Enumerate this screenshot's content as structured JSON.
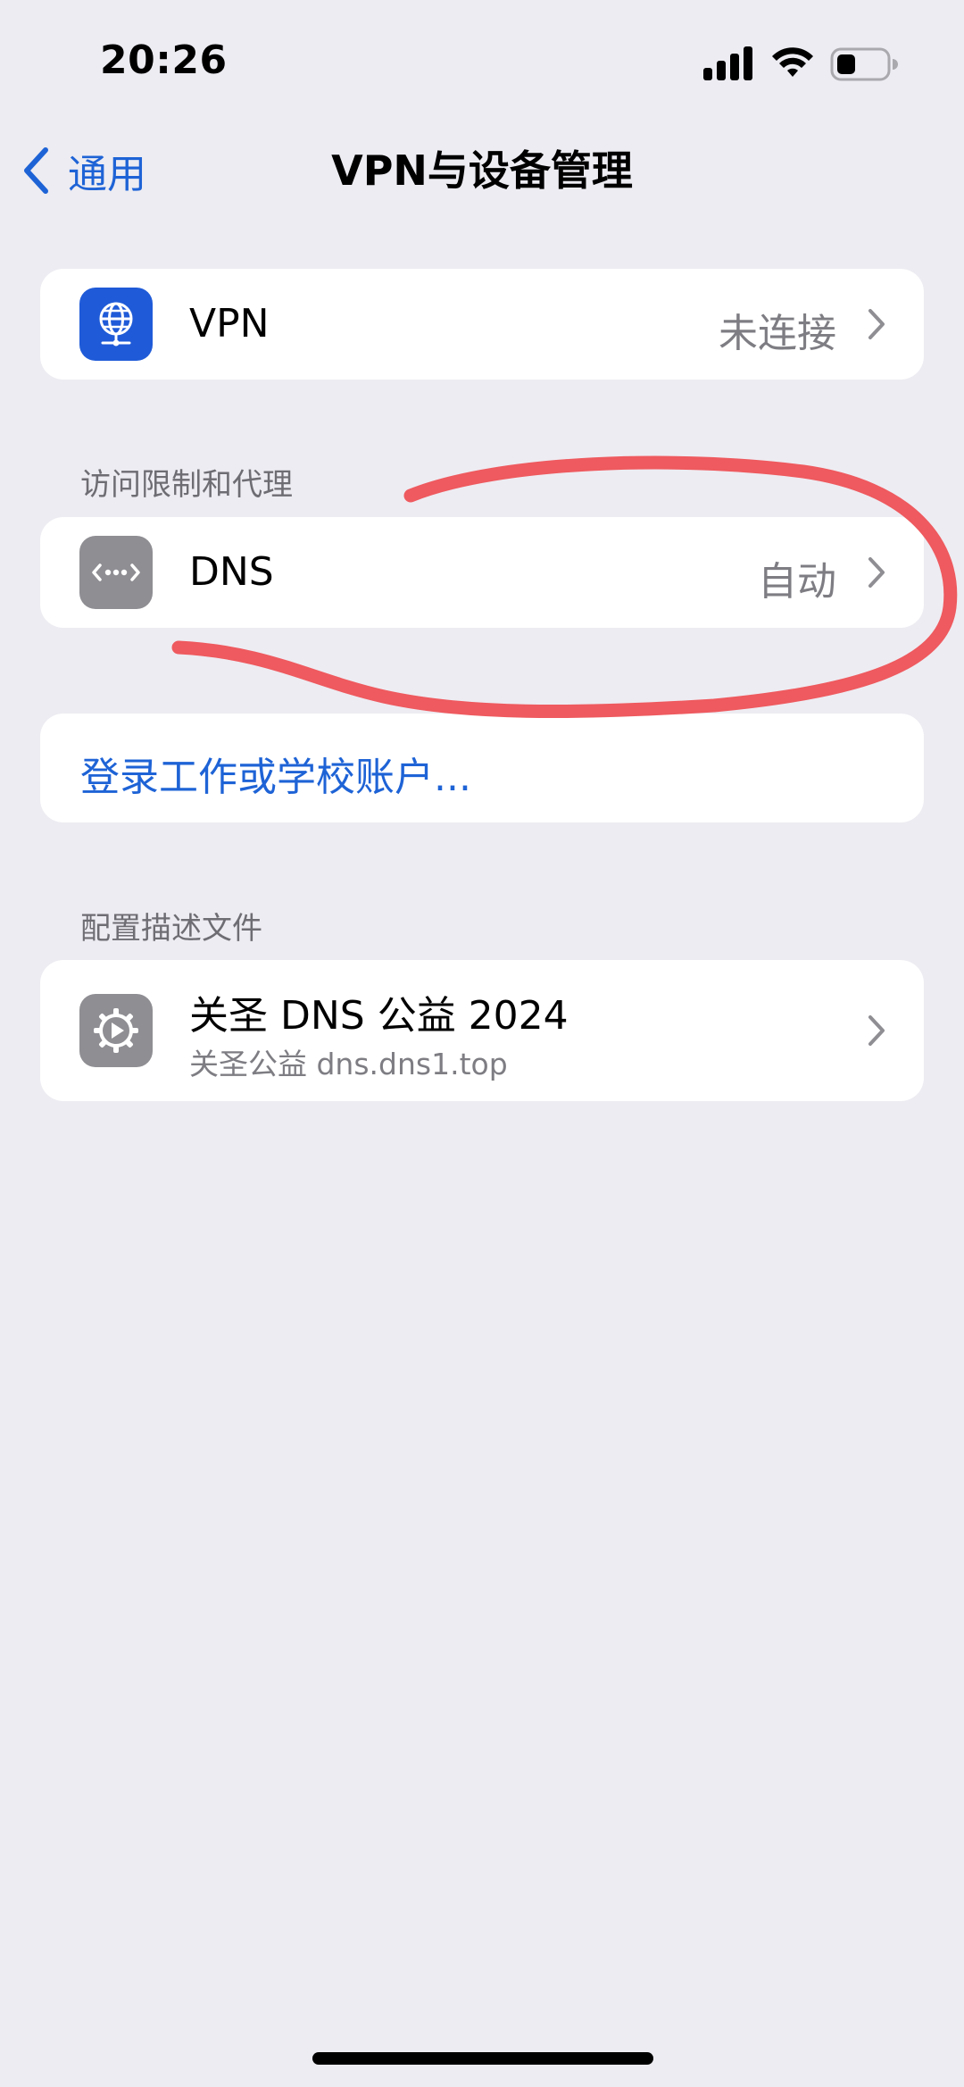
{
  "status_bar": {
    "time": "20:26",
    "icons": [
      "signal-icon",
      "wifi-icon",
      "battery-icon"
    ]
  },
  "nav": {
    "back_label": "通用",
    "title": "VPN与设备管理"
  },
  "vpn_row": {
    "title": "VPN",
    "value": "未连接",
    "icon": "globe-network-icon"
  },
  "section_proxy": {
    "header": "访问限制和代理"
  },
  "dns_row": {
    "title": "DNS",
    "value": "自动",
    "icon": "dns-dots-icon"
  },
  "account_link": {
    "label": "登录工作或学校账户..."
  },
  "section_profile": {
    "header": "配置描述文件"
  },
  "profile_row": {
    "title": "关圣 DNS 公益 2024",
    "subtitle": "关圣公益 dns.dns1.top",
    "icon": "gear-icon"
  },
  "colors": {
    "background": "#EDECF2",
    "card": "#FFFFFF",
    "accent_blue": "#1E63D6",
    "secondary_text": "#7E7D83",
    "vpn_icon_bg": "#1F5BD8",
    "gray_icon_bg": "#8E8E93",
    "annotation_red": "#EE5A5F"
  }
}
